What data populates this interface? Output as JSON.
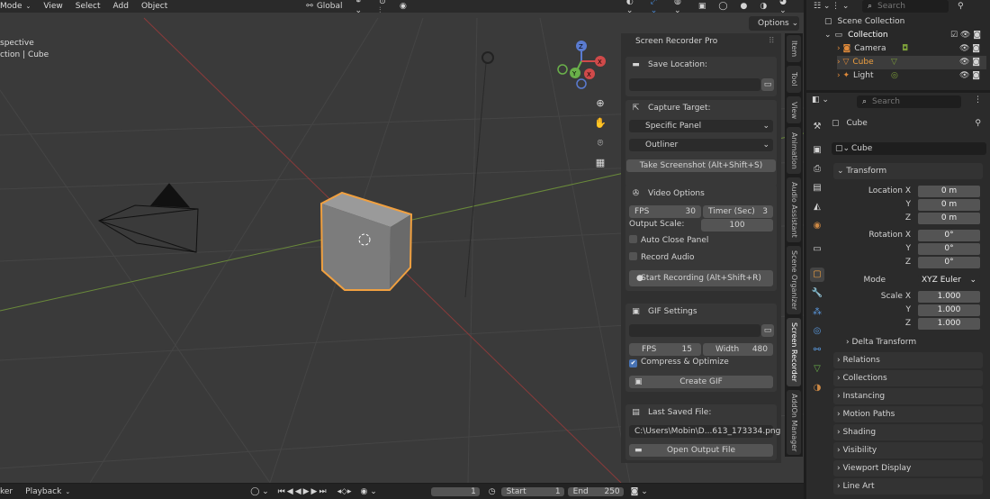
{
  "header": {
    "menu": [
      "Mode",
      "View",
      "Select",
      "Add",
      "Object"
    ],
    "orientation": "Global",
    "options_label": "Options"
  },
  "viewport": {
    "view_name": "spective",
    "collection_info": "ction | Cube",
    "axis_x": "X",
    "axis_y": "Y",
    "axis_z": "Z"
  },
  "recorder": {
    "title": "Screen Recorder Pro",
    "save_location_label": "Save Location:",
    "save_location_value": "",
    "capture_target_label": "Capture Target:",
    "capture_mode": "Specific Panel",
    "capture_panel": "Outliner",
    "screenshot_btn": "Take Screenshot (Alt+Shift+S)",
    "video_title": "Video Options",
    "fps_label": "FPS",
    "fps_value": "30",
    "timer_label": "Timer (Sec)",
    "timer_value": "3",
    "output_scale_label": "Output Scale:",
    "output_scale_value": "100",
    "auto_close_label": "Auto Close Panel",
    "record_audio_label": "Record Audio",
    "record_btn": "Start Recording (Alt+Shift+R)",
    "gif_title": "GIF Settings",
    "gif_path": "",
    "gif_fps_label": "FPS",
    "gif_fps_value": "15",
    "gif_width_label": "Width",
    "gif_width_value": "480",
    "compress_label": "Compress & Optimize",
    "create_gif_btn": "Create GIF",
    "last_saved_label": "Last Saved File:",
    "last_saved_value": "C:\\Users\\Mobin\\D...613_173334.png",
    "open_output_btn": "Open Output File"
  },
  "side_tabs": [
    "Item",
    "Tool",
    "View",
    "Animation",
    "Audio Assistant",
    "Scene Organizer",
    "Screen Recorder",
    "AddOn Manager"
  ],
  "timeline": {
    "marker": "ker",
    "playback": "Playback",
    "frame": "1",
    "start_label": "Start",
    "start_value": "1",
    "end_label": "End",
    "end_value": "250"
  },
  "outliner": {
    "search_placeholder": "Search",
    "scene_collection": "Scene Collection",
    "collection": "Collection",
    "items": [
      "Camera",
      "Cube",
      "Light"
    ]
  },
  "properties": {
    "search_placeholder": "Search",
    "object_name": "Cube",
    "data_name": "Cube",
    "transform": "Transform",
    "location_label": "Location X",
    "rotation_label": "Rotation X",
    "mode_label": "Mode",
    "mode_value": "XYZ Euler",
    "scale_label": "Scale X",
    "y_label": "Y",
    "z_label": "Z",
    "loc": [
      "0 m",
      "0 m",
      "0 m"
    ],
    "rot": [
      "0°",
      "0°",
      "0°"
    ],
    "scale": [
      "1.000",
      "1.000",
      "1.000"
    ],
    "delta": "Delta Transform",
    "sections": [
      "Relations",
      "Collections",
      "Instancing",
      "Motion Paths",
      "Shading",
      "Visibility",
      "Viewport Display",
      "Line Art"
    ]
  }
}
